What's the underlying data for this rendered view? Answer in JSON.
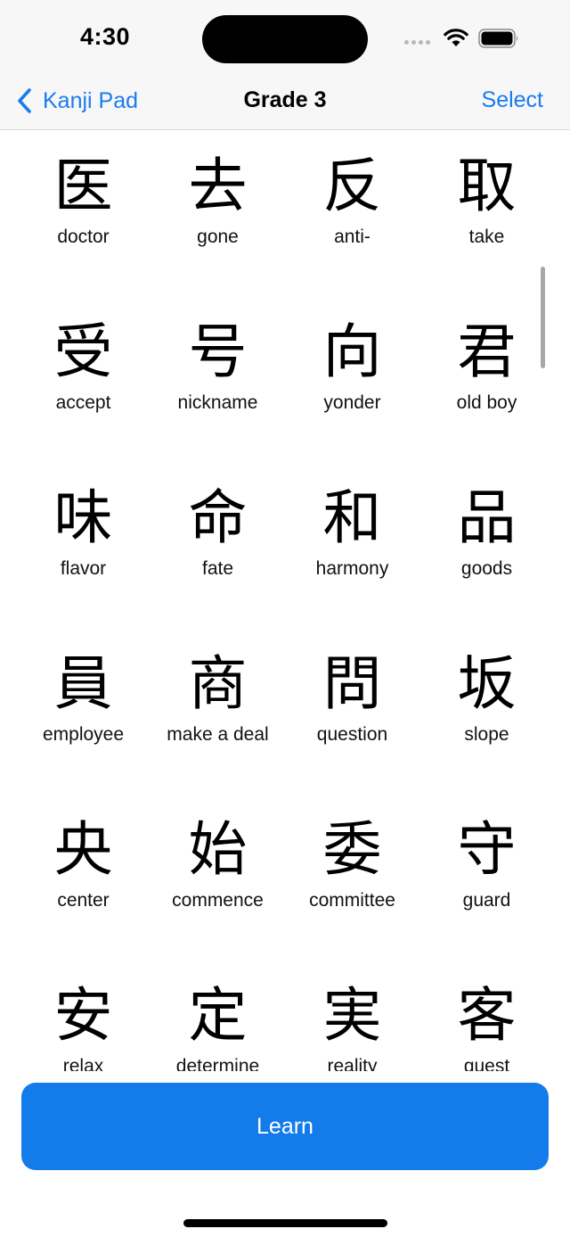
{
  "status_bar": {
    "time": "4:30",
    "icons": [
      "cellular-signal-icon",
      "wifi-icon",
      "battery-icon"
    ]
  },
  "nav": {
    "back_label": "Kanji Pad",
    "back_icon": "chevron-left-icon",
    "title": "Grade 3",
    "select_label": "Select"
  },
  "kanji_grid": [
    {
      "kanji": "医",
      "meaning": "doctor"
    },
    {
      "kanji": "去",
      "meaning": "gone"
    },
    {
      "kanji": "反",
      "meaning": "anti-"
    },
    {
      "kanji": "取",
      "meaning": "take"
    },
    {
      "kanji": "受",
      "meaning": "accept"
    },
    {
      "kanji": "号",
      "meaning": "nickname"
    },
    {
      "kanji": "向",
      "meaning": "yonder"
    },
    {
      "kanji": "君",
      "meaning": "old boy"
    },
    {
      "kanji": "味",
      "meaning": "flavor"
    },
    {
      "kanji": "命",
      "meaning": "fate"
    },
    {
      "kanji": "和",
      "meaning": "harmony"
    },
    {
      "kanji": "品",
      "meaning": "goods"
    },
    {
      "kanji": "員",
      "meaning": "employee"
    },
    {
      "kanji": "商",
      "meaning": "make a deal"
    },
    {
      "kanji": "問",
      "meaning": "question"
    },
    {
      "kanji": "坂",
      "meaning": "slope"
    },
    {
      "kanji": "央",
      "meaning": "center"
    },
    {
      "kanji": "始",
      "meaning": "commence"
    },
    {
      "kanji": "委",
      "meaning": "committee"
    },
    {
      "kanji": "守",
      "meaning": "guard"
    },
    {
      "kanji": "安",
      "meaning": "relax"
    },
    {
      "kanji": "定",
      "meaning": "determine"
    },
    {
      "kanji": "実",
      "meaning": "reality"
    },
    {
      "kanji": "客",
      "meaning": "guest"
    }
  ],
  "learn_button": {
    "label": "Learn"
  },
  "colors": {
    "accent": "#1a7cf0",
    "learn_button_bg": "#147bea",
    "nav_bg": "#f7f7f7"
  }
}
